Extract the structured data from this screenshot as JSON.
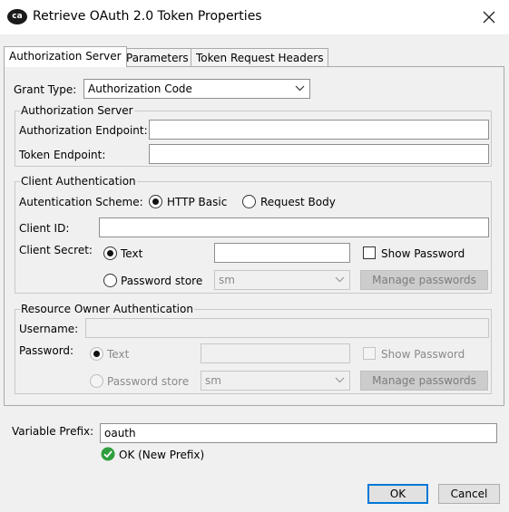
{
  "window": {
    "logo": "ca",
    "title": "Retrieve OAuth 2.0 Token Properties",
    "close_icon": "close-icon"
  },
  "tabs": [
    "Authorization Server",
    "Parameters",
    "Token Request Headers"
  ],
  "grant_type": {
    "label": "Grant Type:",
    "value": "Authorization Code"
  },
  "authorization_server": {
    "legend": "Authorization Server",
    "auth_endpoint_label": "Authorization Endpoint:",
    "auth_endpoint_value": "",
    "token_endpoint_label": "Token Endpoint:",
    "token_endpoint_value": ""
  },
  "client_auth": {
    "legend": "Client Authentication",
    "scheme_label": "Autentication Scheme:",
    "scheme_options": [
      "HTTP Basic",
      "Request Body"
    ],
    "scheme_selected": "HTTP Basic",
    "client_id_label": "Client ID:",
    "client_id_value": "",
    "client_secret_label": "Client Secret:",
    "text_option": "Text",
    "secret_value": "",
    "show_password": "Show Password",
    "password_store_option": "Password store",
    "store_value": "sm",
    "manage_passwords": "Manage passwords"
  },
  "resource_owner": {
    "legend": "Resource Owner Authentication",
    "username_label": "Username:",
    "username_value": "",
    "password_label": "Password:",
    "text_option": "Text",
    "password_value": "",
    "show_password": "Show Password",
    "password_store_option": "Password store",
    "store_value": "sm",
    "manage_passwords": "Manage passwords"
  },
  "variable_prefix": {
    "label": "Variable Prefix:",
    "value": "oauth",
    "status": "OK (New Prefix)"
  },
  "footer": {
    "ok": "OK",
    "cancel": "Cancel"
  },
  "colors": {
    "status_ok": "#2e9e3e",
    "default_button_border": "#0078d7"
  }
}
